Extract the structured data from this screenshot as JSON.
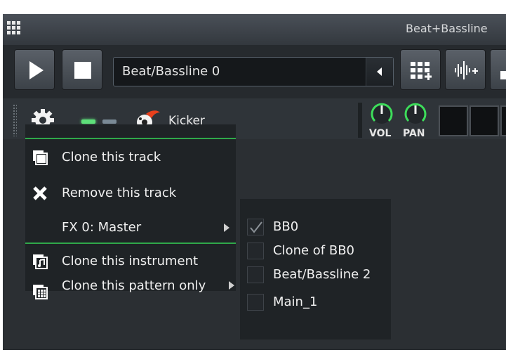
{
  "window": {
    "title": "Beat+Bassline"
  },
  "toolbar": {
    "play_icon": "play-icon",
    "stop_icon": "stop-icon",
    "pattern_select": {
      "value": "Beat/Bassline 0"
    },
    "add_beat_icon": "add-pattern-icon",
    "add_sample_icon": "add-sample-track-icon"
  },
  "track": {
    "name": "Kicker",
    "vol_label": "VOL",
    "pan_label": "PAN"
  },
  "context_menu": {
    "items": [
      {
        "label": "Clone this track",
        "icon": "clone-track-icon"
      },
      {
        "label": "Remove this track",
        "icon": "remove-icon"
      },
      {
        "label": "FX 0: Master",
        "icon": ""
      },
      {
        "label": "Clone this instrument",
        "icon": "clone-instrument-icon"
      },
      {
        "label": "Clone this pattern only",
        "icon": "clone-pattern-icon"
      }
    ]
  },
  "submenu": {
    "items": [
      {
        "label": "BB0",
        "checked": true
      },
      {
        "label": "Clone of BB0",
        "checked": false
      },
      {
        "label": "Beat/Bassline 2",
        "checked": false
      },
      {
        "label": "Main_1",
        "checked": false
      }
    ]
  },
  "colors": {
    "accent": "#2fa84a",
    "knob": "#3ddc5a",
    "background": "#2b2f33"
  }
}
